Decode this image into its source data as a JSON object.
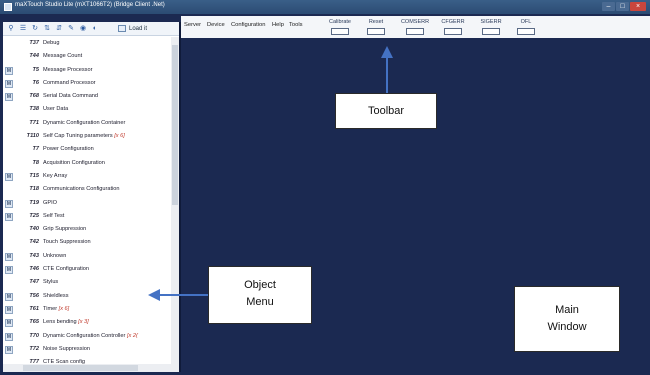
{
  "window": {
    "title": "maXTouch Studio Lite (mXT1066T2) (Bridge Client .Net)"
  },
  "menubar": {
    "items": [
      "Server",
      "Device",
      "Configuration",
      "Help",
      "Tools"
    ]
  },
  "toolbar": {
    "tools": [
      "Calibrate",
      "Reset",
      "COMSERR",
      "CFGERR",
      "SIGERR",
      "OFL"
    ]
  },
  "left_toolbar": {
    "load_label": "Load it"
  },
  "objects": [
    {
      "code": "T37",
      "name": "Debug",
      "extra": "",
      "marker": false
    },
    {
      "code": "T44",
      "name": "Message Count",
      "extra": "",
      "marker": false
    },
    {
      "code": "T5",
      "name": "Message Processor",
      "extra": "",
      "marker": true
    },
    {
      "code": "T6",
      "name": "Command Processor",
      "extra": "",
      "marker": true
    },
    {
      "code": "T68",
      "name": "Serial Data Command",
      "extra": "",
      "marker": true
    },
    {
      "code": "T38",
      "name": "User Data",
      "extra": "",
      "marker": false
    },
    {
      "code": "T71",
      "name": "Dynamic Configuration Container",
      "extra": "",
      "marker": false
    },
    {
      "code": "T110",
      "name": "Self Cap Tuning parameters",
      "extra": "[x 6]",
      "marker": false
    },
    {
      "code": "T7",
      "name": "Power Configuration",
      "extra": "",
      "marker": false
    },
    {
      "code": "T8",
      "name": "Acquisition Configuration",
      "extra": "",
      "marker": false
    },
    {
      "code": "T15",
      "name": "Key Array",
      "extra": "",
      "marker": true
    },
    {
      "code": "T18",
      "name": "Communications Configuration",
      "extra": "",
      "marker": false
    },
    {
      "code": "T19",
      "name": "GPIO",
      "extra": "",
      "marker": true
    },
    {
      "code": "T25",
      "name": "Self Test",
      "extra": "",
      "marker": true
    },
    {
      "code": "T40",
      "name": "Grip Suppression",
      "extra": "",
      "marker": false
    },
    {
      "code": "T42",
      "name": "Touch Suppression",
      "extra": "",
      "marker": false
    },
    {
      "code": "T43",
      "name": "Unknown",
      "extra": "",
      "marker": true
    },
    {
      "code": "T46",
      "name": "CTE Configuration",
      "extra": "",
      "marker": true
    },
    {
      "code": "T47",
      "name": "Stylus",
      "extra": "",
      "marker": false
    },
    {
      "code": "T56",
      "name": "Shieldless",
      "extra": "",
      "marker": true
    },
    {
      "code": "T61",
      "name": "Timer",
      "extra": "[x 6]",
      "marker": true
    },
    {
      "code": "T65",
      "name": "Lens bending",
      "extra": "[x 3]",
      "marker": true
    },
    {
      "code": "T70",
      "name": "Dynamic Configuration Controller",
      "extra": "[x 2(",
      "marker": true
    },
    {
      "code": "T72",
      "name": "Noise Suppression",
      "extra": "",
      "marker": true
    },
    {
      "code": "T77",
      "name": "CTE Scan config",
      "extra": "",
      "marker": false
    }
  ],
  "callouts": {
    "toolbar": "Toolbar",
    "object_menu_line1": "Object",
    "object_menu_line2": "Menu",
    "main_window_line1": "Main",
    "main_window_line2": "Window"
  },
  "colors": {
    "main_background": "#1b2951",
    "arrow": "#4472c4",
    "title_bar": "#2b4b73",
    "count_badge": "#c0392b"
  },
  "icons": {
    "marker": "module-icon"
  }
}
